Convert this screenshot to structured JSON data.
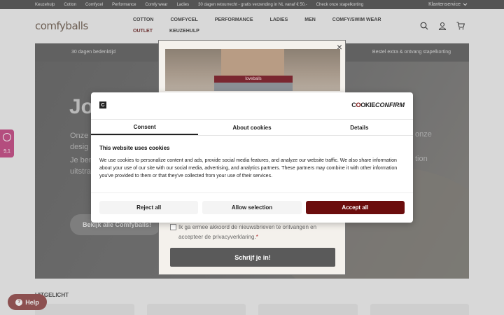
{
  "topbar": {
    "links": [
      "Keuzehulp",
      "Cotton",
      "Comfycel",
      "Performance",
      "Comfy wear",
      "Ladies",
      "30 dagen retourrecht - gratis verzending in NL vanaf € 50,-",
      "Check onze stapelkorting"
    ],
    "account_label": "Klantenservice"
  },
  "header": {
    "logo": "comfyballs",
    "nav": [
      "COTTON",
      "COMFYCEL",
      "PERFORMANCE",
      "LADIES",
      "MEN",
      "COMFY/SWIM WEAR",
      "OUTLET",
      "KEUZEHULP"
    ],
    "icons": [
      "search-icon",
      "user-icon",
      "cart-icon"
    ]
  },
  "usp": {
    "left": "30 dagen bedenktijd",
    "right": "Bestel extra & ontvang stapelkorting"
  },
  "hero": {
    "title": "Jo",
    "line1": "Onze",
    "line1_end": "onze",
    "line2": "desig",
    "line3": "Je ben",
    "line3_end": "tion",
    "line4": "uitstra",
    "button": "Bekijk alle Comfyballs!"
  },
  "side_badge": {
    "score": "9,1"
  },
  "help": {
    "label": "Help"
  },
  "featured": {
    "label": "UITGELICHT"
  },
  "newsletter": {
    "close": "×",
    "band_text": "loveballs",
    "consent_text": "Ik ga ermee akkoord de nieuwsbrieven te ontvangen en accepteer de privacyverklaring.",
    "consent_star": "*",
    "subscribe": "Schrijf je in!"
  },
  "cookie": {
    "logo_letter": "C",
    "brand_a": "C",
    "brand_o": "O",
    "brand_b": "OKIE",
    "brand_c": "CONFIRM",
    "tabs": [
      "Consent",
      "About cookies",
      "Details"
    ],
    "active_tab": "Consent",
    "heading": "This website uses cookies",
    "body": "We use cookies to personalize content and ads, provide social media features, and analyze our website traffic. We also share information about your use of our site with our social media, advertising, and analytics partners. These partners may combine it with other information you've provided to them or that they've collected from your use of their services.",
    "reject": "Reject all",
    "allow_selection": "Allow selection",
    "accept": "Accept all",
    "accent": "#6b0d0d"
  }
}
